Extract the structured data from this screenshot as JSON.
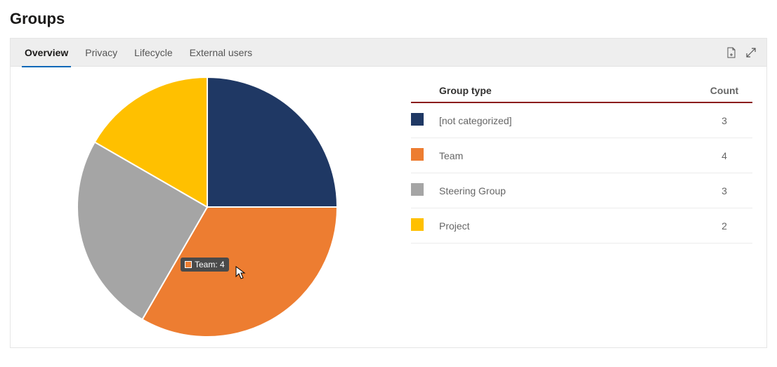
{
  "page": {
    "title": "Groups"
  },
  "tabs": [
    {
      "label": "Overview",
      "active": true
    },
    {
      "label": "Privacy",
      "active": false
    },
    {
      "label": "Lifecycle",
      "active": false
    },
    {
      "label": "External users",
      "active": false
    }
  ],
  "table": {
    "headers": {
      "type": "Group type",
      "count": "Count"
    },
    "rows": [
      {
        "label": "[not categorized]",
        "count": 3,
        "color": "#1f3864"
      },
      {
        "label": "Team",
        "count": 4,
        "color": "#ed7d31"
      },
      {
        "label": "Steering Group",
        "count": 3,
        "color": "#a5a5a5"
      },
      {
        "label": "Project",
        "count": 2,
        "color": "#ffc000"
      }
    ]
  },
  "tooltip": {
    "swatch": "#ed7d31",
    "text": "Team: 4"
  },
  "chart_data": {
    "type": "pie",
    "title": "",
    "categories": [
      "[not categorized]",
      "Team",
      "Steering Group",
      "Project"
    ],
    "values": [
      3,
      4,
      3,
      2
    ],
    "colors": [
      "#1f3864",
      "#ed7d31",
      "#a5a5a5",
      "#ffc000"
    ]
  }
}
